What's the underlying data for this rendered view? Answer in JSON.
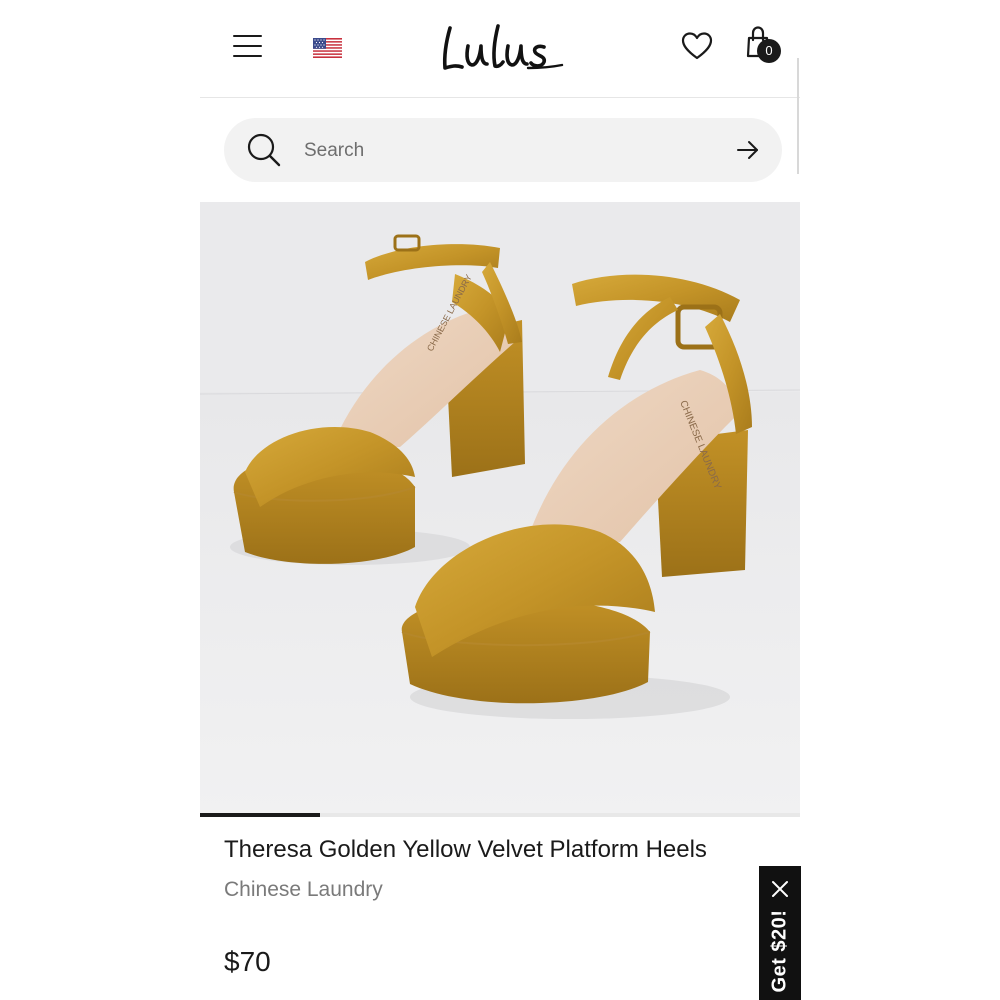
{
  "header": {
    "logo_text": "Lulus",
    "bag_count": "0",
    "menu_icon": "hamburger-menu-icon",
    "flag_icon": "us-flag-icon",
    "wishlist_icon": "heart-icon",
    "bag_icon": "shopping-bag-icon"
  },
  "search": {
    "placeholder": "Search",
    "value": "",
    "search_icon": "search-icon",
    "submit_icon": "arrow-right-icon"
  },
  "product": {
    "title": "Theresa Golden Yellow Velvet Platform Heels",
    "brand": "Chinese Laundry",
    "price": "$70",
    "insole_brand_text": "CHINESE LAUNDRY",
    "image_carousel_progress": 0.2
  },
  "promo": {
    "label": "Get $20!",
    "close_icon": "close-icon"
  },
  "colors": {
    "text": "#1a1a1a",
    "muted": "#7a7a7a",
    "search_bg": "#f2f2f2",
    "velvet": "#c89a2e",
    "promo_bg": "#111111"
  }
}
